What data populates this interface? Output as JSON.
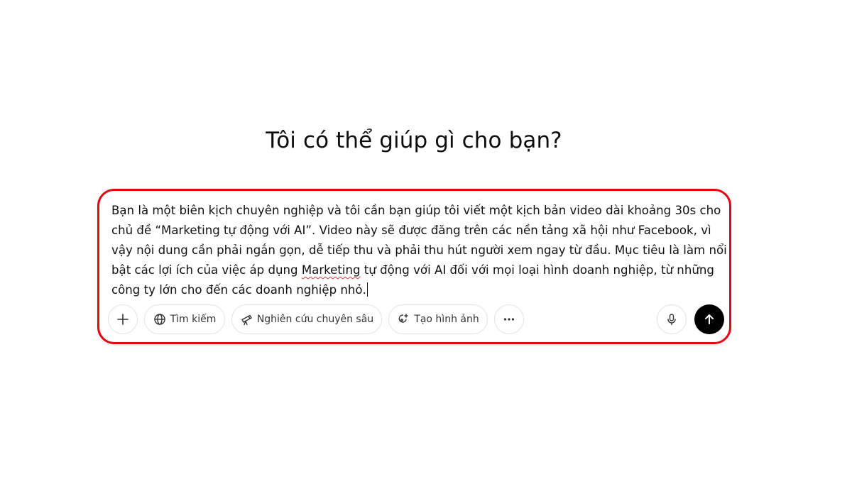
{
  "header": {
    "title": "Tôi có thể giúp gì cho bạn?"
  },
  "composer": {
    "lines": [
      "Bạn là một biên kịch chuyên nghiệp và tôi cần bạn giúp tôi viết một kịch bản video dài khoảng 30s cho",
      "chủ đề “Marketing tự động với AI”. Video này sẽ được đăng trên các nền tảng xã hội như Facebook, vì",
      "vậy nội dung cần phải ngắn gọn, dễ tiếp thu và phải thu hút người xem ngay từ đầu. Mục tiêu là làm nổi",
      "công ty lớn cho đến các doanh nghiệp nhỏ."
    ],
    "line4_before": "bật các lợi ích của việc áp dụng ",
    "line4_flagged": "Marketing",
    "line4_after": " tự động với AI đối với mọi loại hình doanh nghiệp, từ những",
    "highlight_color": "#e30613"
  },
  "toolbar": {
    "add_icon": "plus-icon",
    "search_label": "Tìm kiếm",
    "search_icon": "globe-icon",
    "research_label": "Nghiên cứu chuyên sâu",
    "research_icon": "telescope-icon",
    "image_label": "Tạo hình ảnh",
    "image_icon": "image-sparkle-icon",
    "more_icon": "more-dots-icon",
    "mic_icon": "microphone-icon",
    "send_icon": "arrow-up-icon"
  }
}
